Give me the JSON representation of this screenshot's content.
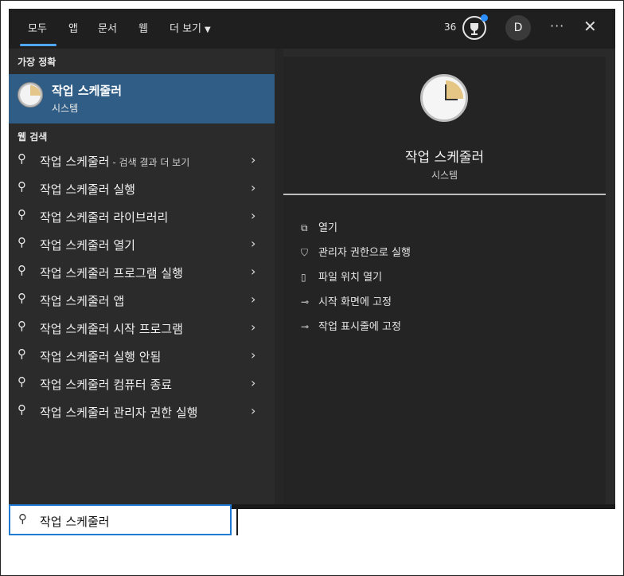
{
  "tabs": [
    {
      "label": "모두"
    },
    {
      "label": "앱"
    },
    {
      "label": "문서"
    },
    {
      "label": "웹"
    },
    {
      "label": "더 보기"
    }
  ],
  "header": {
    "points": "36",
    "avatar_initial": "D",
    "more": "···",
    "close": "✕"
  },
  "best_match": {
    "section_title": "가장 정확",
    "title": "작업 스케줄러",
    "subtitle": "시스템"
  },
  "web_search": {
    "section_title": "웹 검색",
    "items": [
      {
        "label": "작업 스케줄러",
        "suffix": " - 검색 결과 더 보기"
      },
      {
        "label": "작업 스케줄러 실행",
        "suffix": ""
      },
      {
        "label": "작업 스케줄러 라이브러리",
        "suffix": ""
      },
      {
        "label": "작업 스케줄러 열기",
        "suffix": ""
      },
      {
        "label": "작업 스케줄러 프로그램 실행",
        "suffix": ""
      },
      {
        "label": "작업 스케줄러 앱",
        "suffix": ""
      },
      {
        "label": "작업 스케줄러 시작 프로그램",
        "suffix": ""
      },
      {
        "label": "작업 스케줄러 실행 안됨",
        "suffix": ""
      },
      {
        "label": "작업 스케줄러 컴퓨터 종료",
        "suffix": ""
      },
      {
        "label": "작업 스케줄러 관리자 권한 실행",
        "suffix": ""
      }
    ]
  },
  "detail": {
    "title": "작업 스케줄러",
    "subtitle": "시스템",
    "actions": [
      {
        "label": "열기",
        "icon": "open-icon"
      },
      {
        "label": "관리자 권한으로 실행",
        "icon": "shield-icon"
      },
      {
        "label": "파일 위치 열기",
        "icon": "file-icon"
      },
      {
        "label": "시작 화면에 고정",
        "icon": "pin-icon"
      },
      {
        "label": "작업 표시줄에 고정",
        "icon": "pin-icon"
      }
    ]
  },
  "search": {
    "value": "작업 스케줄러"
  },
  "colors": {
    "accent": "#4fa7ff",
    "selected": "#2f5d86",
    "badge": "#2b8fff"
  }
}
